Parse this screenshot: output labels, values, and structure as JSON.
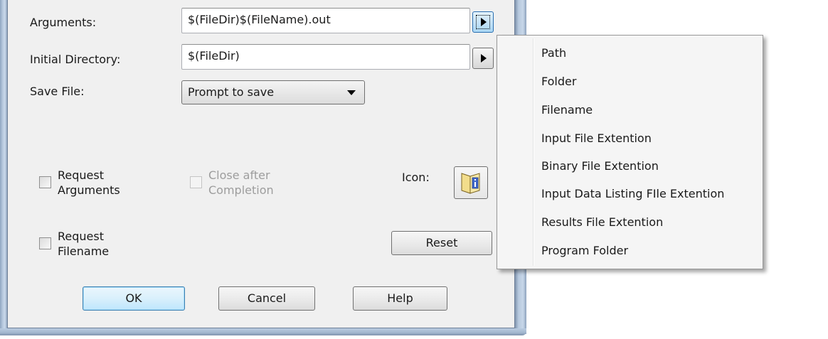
{
  "form": {
    "arguments_label": "Arguments:",
    "arguments_value": "$(FileDir)$(FileName).out",
    "initial_directory_label": "Initial Directory:",
    "initial_directory_value": "$(FileDir)",
    "save_file_label": "Save File:",
    "save_file_selected": "Prompt to save",
    "request_arguments_label": "Request\nArguments",
    "request_arguments_checked": false,
    "close_after_label": "Close after\nCompletion",
    "close_after_checked": false,
    "close_after_enabled": false,
    "icon_label": "Icon:",
    "request_filename_label": "Request\nFilename",
    "request_filename_checked": false,
    "reset_label": "Reset"
  },
  "footer": {
    "ok_label": "OK",
    "cancel_label": "Cancel",
    "help_label": "Help"
  },
  "menu": {
    "items": [
      "Path",
      "Folder",
      "Filename",
      "Input File Extention",
      "Binary File Extention",
      "Input Data Listing FIle Extention",
      "Results File Extention",
      "Program Folder"
    ]
  },
  "colors": {
    "dialog_bg": "#f0f0f0",
    "frame": "#b9cbe0",
    "default_button": "#d9f0fc"
  }
}
